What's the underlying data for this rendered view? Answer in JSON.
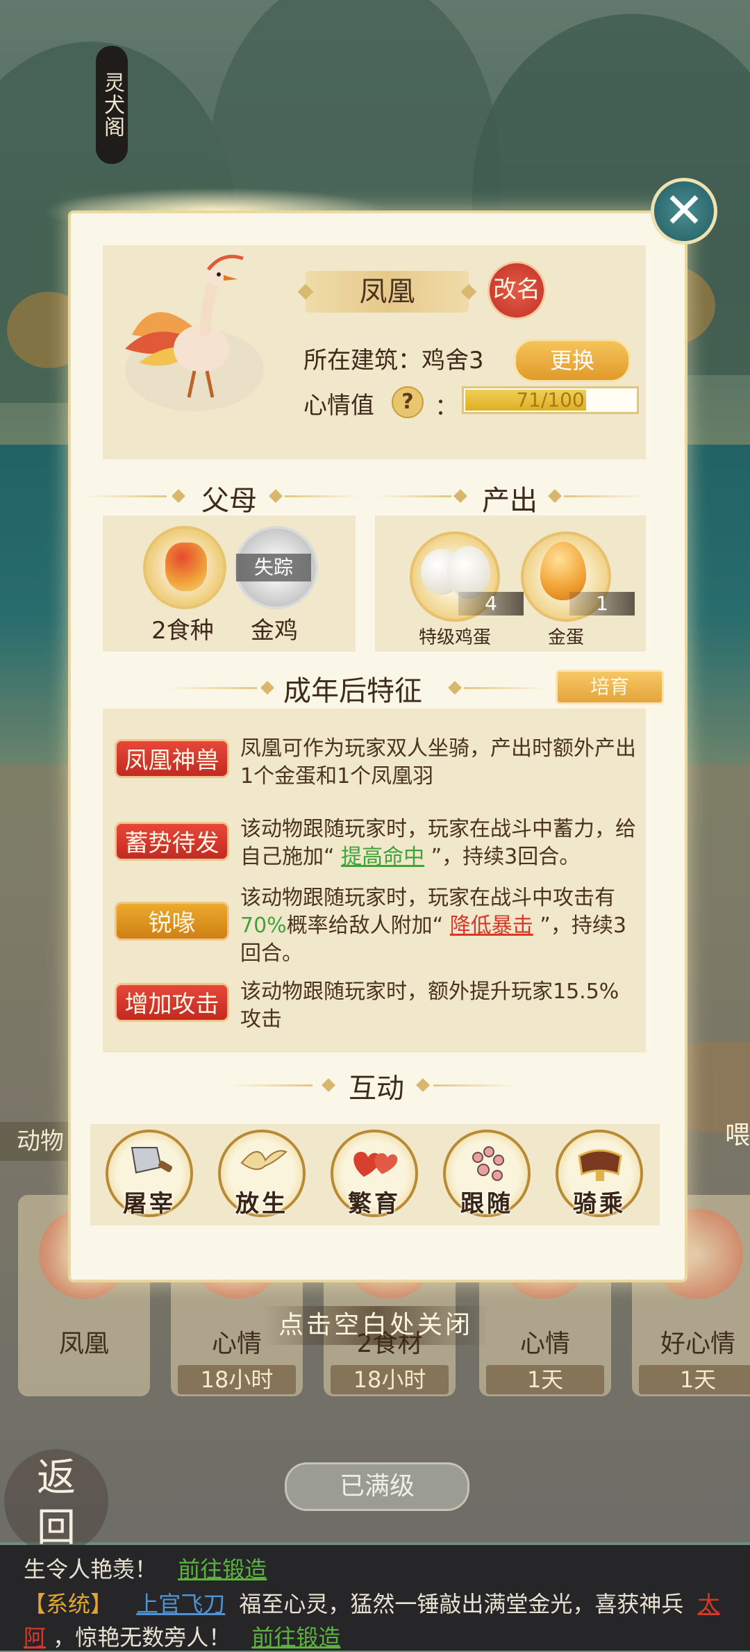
{
  "side_title": "灵犬阁",
  "background": {
    "animal_tab": "动物",
    "feed_button": "喂",
    "cards": [
      {
        "name": "凤凰",
        "time": ""
      },
      {
        "name": "心情",
        "time": "18小时"
      },
      {
        "name": "2食材",
        "time": "18小时"
      },
      {
        "name": "心情",
        "time": "1天"
      },
      {
        "name": "好心情",
        "time": "1天"
      }
    ],
    "close_hint": "点击空白处关闭",
    "max_level_button": "已满级",
    "back_button": {
      "line1": "返",
      "line2": "回"
    }
  },
  "panel": {
    "animal_name": "凤凰",
    "rename_button": "改名",
    "building_label": "所在建筑：鸡舍3",
    "change_button": "更换",
    "mood_label": "心情值",
    "mood_help": "?",
    "mood_colon": "：",
    "mood": {
      "text": "71/100",
      "current": 71,
      "max": 100
    },
    "parents_title": "父母",
    "output_title": "产出",
    "parents": [
      {
        "name": "2食种",
        "status": ""
      },
      {
        "name": "金鸡",
        "status": "失踪"
      }
    ],
    "outputs": [
      {
        "name": "特级鸡蛋",
        "count": "4"
      },
      {
        "name": "金蛋",
        "count": "1"
      }
    ],
    "traits_title": "成年后特征",
    "breed_button": "培育",
    "traits": [
      {
        "badge": "凤凰神兽",
        "color": "#d23a2e",
        "text": "凤凰可作为玩家双人坐骑，产出时额外产出1个金蛋和1个凤凰羽"
      },
      {
        "badge": "蓄势待发",
        "color": "#d23a2e",
        "pre": "该动物跟随玩家时，玩家在战斗中蓄力，给自己施加“ ",
        "link": "提高命中",
        "post": " ”，持续3回合。"
      },
      {
        "badge": "锐喙",
        "color": "#df9420",
        "pre": "该动物跟随玩家时，玩家在战斗中攻击有",
        "pct": "70%",
        "mid": "概率给敌人附加“ ",
        "link": "降低暴击",
        "post": " ”，持续3回合。"
      },
      {
        "badge": "增加攻击",
        "color": "#d23a2e",
        "text": "该动物跟随玩家时，额外提升玩家15.5%攻击"
      }
    ],
    "interact_title": "互动",
    "actions": [
      {
        "label": "屠宰",
        "icon": "cleaver-icon"
      },
      {
        "label": "放生",
        "icon": "bird-icon"
      },
      {
        "label": "繁育",
        "icon": "hearts-icon"
      },
      {
        "label": "跟随",
        "icon": "pawprints-icon"
      },
      {
        "label": "骑乘",
        "icon": "saddle-icon"
      }
    ]
  },
  "chat": {
    "line1_text": "生令人艳羡！",
    "line1_link": "前往锻造",
    "line2_tag": "【系统】",
    "line2_user": "上官飞刀",
    "line2_text": "福至心灵，猛然一锤敲出满堂金光，喜获神兵",
    "line2_item_a": "太",
    "line3_item_b": "阿",
    "line3_text": "，惊艳无数旁人！",
    "line3_link": "前往锻造"
  }
}
